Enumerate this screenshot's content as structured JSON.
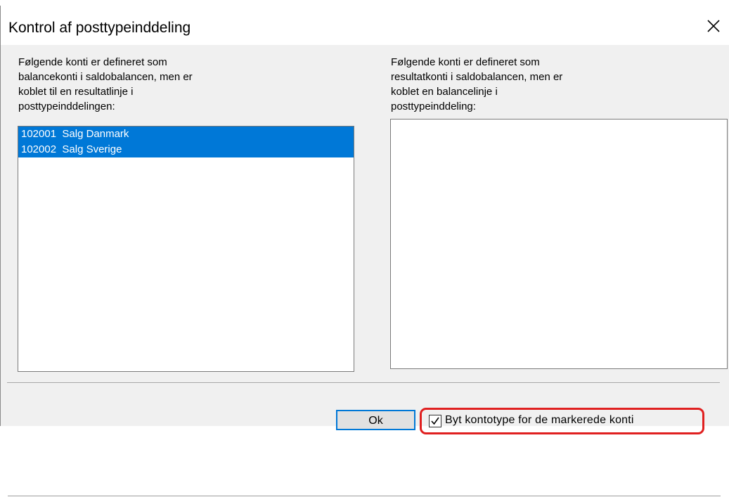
{
  "dialog": {
    "title": "Kontrol af posttypeinddeling"
  },
  "left_panel": {
    "label": "Følgende konti er defineret som\nbalancekonti i saldobalancen, men er\nkoblet til en resultatlinje i\nposttypeinddelingen:",
    "items": [
      {
        "text": "102001  Salg Danmark",
        "selected": true
      },
      {
        "text": "102002  Salg Sverige",
        "selected": true
      }
    ]
  },
  "right_panel": {
    "label": "Følgende konti er defineret som\nresultatkonti i saldobalancen, men er\nkoblet en balancelinje i\nposttypeinddeling:",
    "items": []
  },
  "footer": {
    "ok_label": "Ok",
    "checkbox_label": "Byt kontotype for de markerede konti",
    "checkbox_checked": true
  },
  "colors": {
    "selection": "#0078d7",
    "highlight": "#e02020"
  },
  "icons": {
    "close": "close-icon",
    "check": "checkmark-icon"
  }
}
